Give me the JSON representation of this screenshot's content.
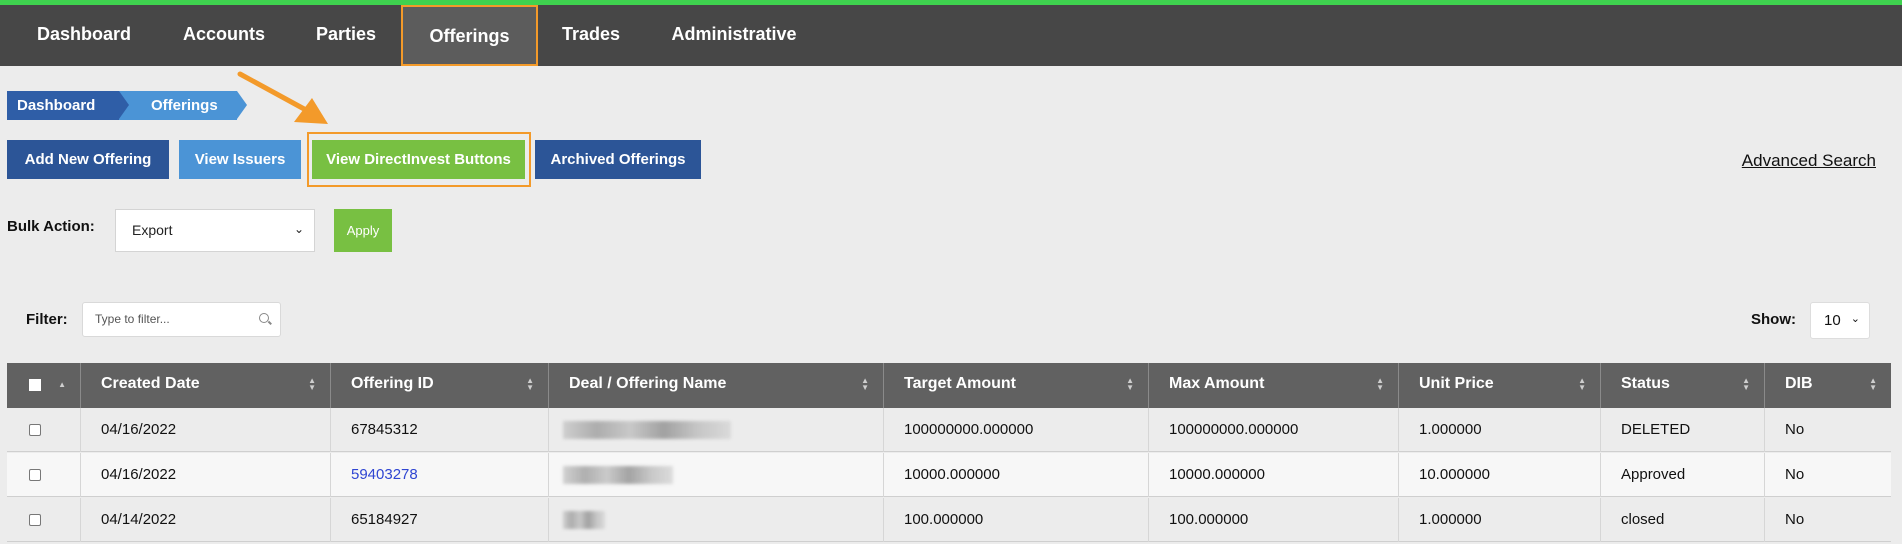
{
  "nav": {
    "items": [
      {
        "label": "Dashboard"
      },
      {
        "label": "Accounts"
      },
      {
        "label": "Parties"
      },
      {
        "label": "Offerings"
      },
      {
        "label": "Trades"
      },
      {
        "label": "Administrative"
      }
    ],
    "active": "Offerings"
  },
  "breadcrumb": [
    "Dashboard",
    "Offerings"
  ],
  "actions": {
    "add_new": "Add New Offering",
    "view_issuers": "View Issuers",
    "view_directinvest": "View DirectInvest Buttons",
    "archived": "Archived Offerings",
    "advanced_search": "Advanced Search"
  },
  "bulk": {
    "label": "Bulk Action:",
    "selected": "Export",
    "apply": "Apply"
  },
  "filter": {
    "label": "Filter:",
    "placeholder": "Type to filter..."
  },
  "show": {
    "label": "Show:",
    "value": "10"
  },
  "table": {
    "columns": [
      "Created Date",
      "Offering ID",
      "Deal / Offering Name",
      "Target Amount",
      "Max Amount",
      "Unit Price",
      "Status",
      "DIB"
    ],
    "rows": [
      {
        "created": "04/16/2022",
        "offering_id": "67845312",
        "target": "100000000.000000",
        "max": "100000000.000000",
        "unit_price": "1.000000",
        "status": "DELETED",
        "dib": "No"
      },
      {
        "created": "04/16/2022",
        "offering_id": "59403278",
        "target": "10000.000000",
        "max": "10000.000000",
        "unit_price": "10.000000",
        "status": "Approved",
        "dib": "No"
      },
      {
        "created": "04/14/2022",
        "offering_id": "65184927",
        "target": "100.000000",
        "max": "100.000000",
        "unit_price": "1.000000",
        "status": "closed",
        "dib": "No"
      }
    ]
  },
  "colors": {
    "nav_bg": "#474747",
    "accent_green": "#78c042",
    "primary_blue": "#2c5597",
    "light_blue": "#4b94d6",
    "highlight_orange": "#f39a2a",
    "link_blue": "#2f45d2"
  }
}
